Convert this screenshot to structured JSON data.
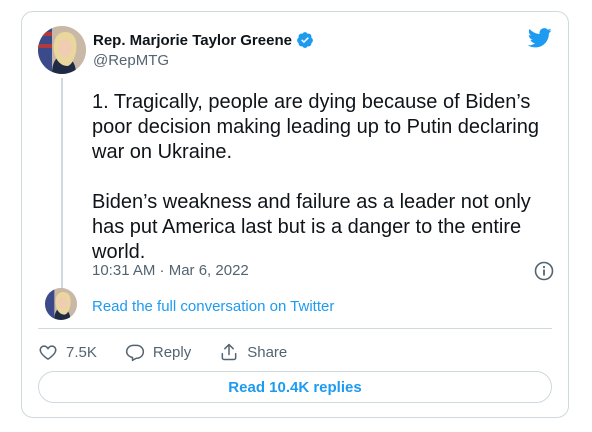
{
  "author": {
    "name": "Rep. Marjorie Taylor Greene",
    "handle": "@RepMTG",
    "verified": true
  },
  "tweet": {
    "text": "1. Tragically, people are dying because of Biden’s\npoor decision making leading up to Putin declaring\nwar on Ukraine.\n\nBiden’s weakness and failure as a leader not only\nhas put America last but is a danger to the entire\nworld.",
    "timestamp": "10:31 AM · Mar 6, 2022"
  },
  "thread": {
    "link_label": "Read the full conversation on Twitter"
  },
  "actions": {
    "likes": "7.5K",
    "reply_label": "Reply",
    "share_label": "Share"
  },
  "replies_button": {
    "label": "Read 10.4K replies"
  },
  "colors": {
    "accent": "#1d9bf0",
    "text": "#0f1419",
    "secondary": "#536471",
    "border": "#cfd9de"
  },
  "icons": [
    "twitter-bird-icon",
    "verified-badge-icon",
    "info-icon",
    "heart-icon",
    "reply-icon",
    "share-icon"
  ]
}
